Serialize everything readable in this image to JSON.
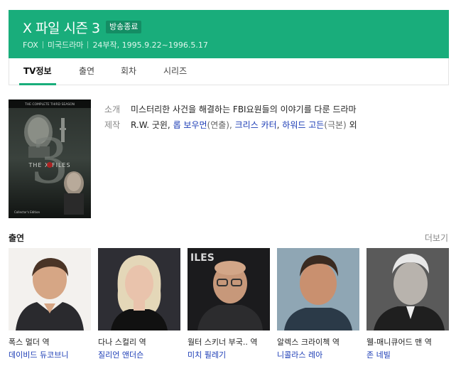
{
  "header": {
    "title": "X 파일 시즌 3",
    "badge": "방송종료",
    "network": "FOX",
    "genre": "미국드라마",
    "episodes_dates": "24부작,  1995.9.22~1996.5.17"
  },
  "tabs": [
    {
      "label": "TV정보",
      "active": true
    },
    {
      "label": "출연",
      "active": false
    },
    {
      "label": "회차",
      "active": false
    },
    {
      "label": "시리즈",
      "active": false
    }
  ],
  "info": {
    "summary_label": "소개",
    "summary": "미스터리한 사건을 해결하는 FBI요원들의 이야기를 다룬 드라마",
    "production_label": "제작",
    "producer_plain": "R.W. 굿윈, ",
    "director": "롭 보우먼",
    "director_role": "(연출), ",
    "writer1": "크리스 카터",
    "comma": ", ",
    "writer2": "하워드 고든",
    "writer_role": "(극본)",
    "suffix": " 외"
  },
  "poster": {
    "series_text": "THE COMPLETE THIRD SEASON",
    "logo_text": "THE X FILES",
    "season_number": "3",
    "edition_text": "Collector's Edition"
  },
  "cast": {
    "heading": "출연",
    "more": "더보기",
    "members": [
      {
        "role": "폭스 멀더 역",
        "actor": "데이비드 듀코브니"
      },
      {
        "role": "다나 스컬리 역",
        "actor": "질리언 앤더슨"
      },
      {
        "role": "월터 스키너 부국.. 역",
        "actor": "미치 필레기"
      },
      {
        "role": "알렉스 크라이첵 역",
        "actor": "니콜라스 레아"
      },
      {
        "role": "웰-매니큐어드 맨 역",
        "actor": "존 네빌"
      }
    ]
  },
  "colors": {
    "brand_green": "#19ad7b",
    "link_blue": "#1a3bb5"
  }
}
